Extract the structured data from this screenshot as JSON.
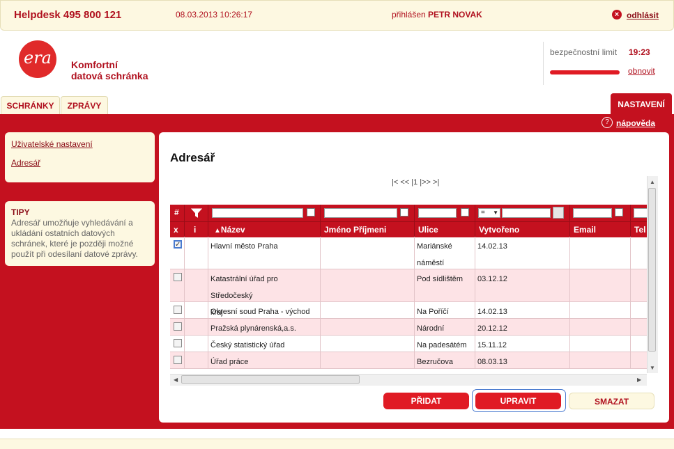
{
  "topbar": {
    "helpdesk": "Helpdesk 495 800 121",
    "datetime": "08.03.2013 10:26:17",
    "logged_prefix": "přihlášen",
    "user": "PETR NOVAK",
    "logout": "odhlásit"
  },
  "header": {
    "logo_text": "era",
    "brand_line1": "Komfortní",
    "brand_line2": "datová schránka",
    "security_label": "bezpečnostní limit",
    "security_time": "19:23",
    "refresh": "obnovit"
  },
  "tabs": {
    "boxes": "SCHRÁNKY",
    "messages": "ZPRÁVY",
    "settings": "NASTAVENÍ"
  },
  "help": "nápověda",
  "sidebar": {
    "nav": [
      "Uživatelské nastavení",
      "Adresář"
    ],
    "tips_title": "TIPY",
    "tips_text": "Adresář umožňuje vyhledávání a ukládání ostatních datových schránek, které je později možné použít při odesílaní datové zprávy."
  },
  "main": {
    "title": "Adresář",
    "pager": "|< << |1 |>> >|",
    "filter_operator": "=",
    "columns": [
      "x",
      "i",
      "Název",
      "Jméno Příjmeni",
      "Ulice",
      "Vytvořeno",
      "Email",
      "Tel"
    ],
    "filter_hash": "#",
    "rows": [
      {
        "checked": true,
        "name": "Hlavní město Praha",
        "name2": "",
        "person": "",
        "street": "Mariánské",
        "street2": "náměstí",
        "created": "14.02.13",
        "email": ""
      },
      {
        "checked": false,
        "name": "Katastrální úřad pro Středočeský",
        "name2": "kraj",
        "person": "",
        "street": "Pod sídlištěm",
        "street2": "",
        "created": "03.12.12",
        "email": ""
      },
      {
        "checked": false,
        "name": "Okresní soud Praha - východ",
        "name2": "",
        "person": "",
        "street": "Na Poříčí",
        "street2": "",
        "created": "14.02.13",
        "email": ""
      },
      {
        "checked": false,
        "name": "Pražská plynárenská,a.s.",
        "name2": "",
        "person": "",
        "street": "Národní",
        "street2": "",
        "created": "20.12.12",
        "email": ""
      },
      {
        "checked": false,
        "name": "Český statistický úřad",
        "name2": "",
        "person": "",
        "street": "Na padesátém",
        "street2": "",
        "created": "15.11.12",
        "email": ""
      },
      {
        "checked": false,
        "name": "Úřad práce",
        "name2": "",
        "person": "",
        "street": "Bezručova",
        "street2": "",
        "created": "08.03.13",
        "email": ""
      }
    ]
  },
  "buttons": {
    "add": "PŘIDAT",
    "edit": "UPRAVIT",
    "delete": "SMAZAT"
  },
  "icons": {
    "logout": "close-icon",
    "help": "question-icon",
    "filter": "funnel-icon",
    "calendar": "calendar-icon",
    "sort": "sort-up-icon"
  },
  "colors": {
    "brand_red": "#c4111f",
    "cream": "#fdf8e1",
    "row_alt": "#fde3e6"
  }
}
